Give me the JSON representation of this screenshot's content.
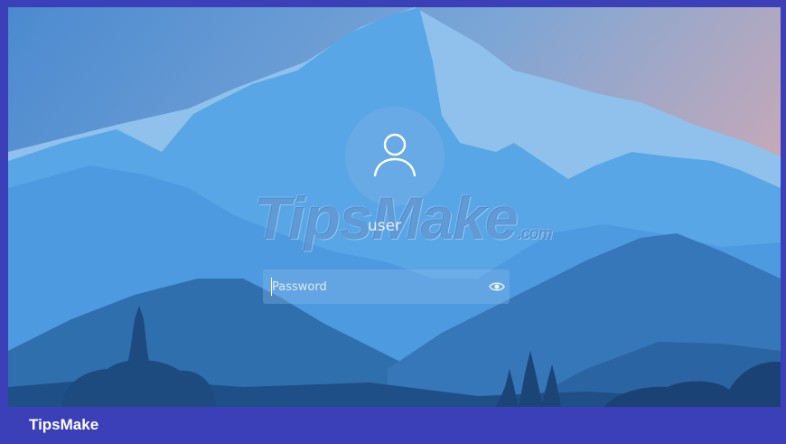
{
  "lock_screen": {
    "username": "user",
    "password_placeholder": "Password",
    "avatar_icon": "user-icon",
    "reveal_icon": "eye-icon"
  },
  "watermark": {
    "brand": "TipsMake",
    "suffix": ".com"
  },
  "footer": {
    "brand": "TipsMake"
  },
  "colors": {
    "frame": "#3b3fb8",
    "sky_top": "#4f8fd0",
    "mountain_light": "#8ec0ec",
    "mountain_mid": "#5aa5e4",
    "mountain_dark": "#2e6aa6"
  }
}
